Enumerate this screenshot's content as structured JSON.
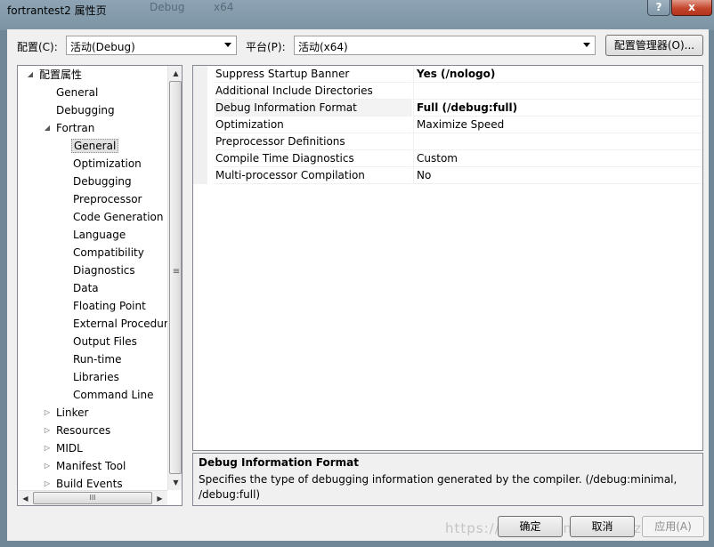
{
  "window": {
    "title": "fortrantest2 属性页",
    "ghost_menu": [
      "Debug",
      "x64"
    ],
    "help_label": "?",
    "close_label": "x"
  },
  "top": {
    "config_label": "配置(C):",
    "config_value": "活动(Debug)",
    "platform_label": "平台(P):",
    "platform_value": "活动(x64)",
    "config_manager": "配置管理器(O)..."
  },
  "tree": {
    "items": [
      {
        "label": "配置属性",
        "expander": "◢"
      },
      {
        "label": "General",
        "expander": ""
      },
      {
        "label": "Debugging",
        "expander": ""
      },
      {
        "label": "Fortran",
        "expander": "◢"
      },
      {
        "label": "General",
        "expander": ""
      },
      {
        "label": "Optimization",
        "expander": ""
      },
      {
        "label": "Debugging",
        "expander": ""
      },
      {
        "label": "Preprocessor",
        "expander": ""
      },
      {
        "label": "Code Generation",
        "expander": ""
      },
      {
        "label": "Language",
        "expander": ""
      },
      {
        "label": "Compatibility",
        "expander": ""
      },
      {
        "label": "Diagnostics",
        "expander": ""
      },
      {
        "label": "Data",
        "expander": ""
      },
      {
        "label": "Floating Point",
        "expander": ""
      },
      {
        "label": "External Procedur",
        "expander": ""
      },
      {
        "label": "Output Files",
        "expander": ""
      },
      {
        "label": "Run-time",
        "expander": ""
      },
      {
        "label": "Libraries",
        "expander": ""
      },
      {
        "label": "Command Line",
        "expander": ""
      },
      {
        "label": "Linker",
        "expander": "▷"
      },
      {
        "label": "Resources",
        "expander": "▷"
      },
      {
        "label": "MIDL",
        "expander": "▷"
      },
      {
        "label": "Manifest Tool",
        "expander": "▷"
      },
      {
        "label": "Build Events",
        "expander": "▷"
      }
    ],
    "hscroll_grip": "III",
    "vscroll_grip": "≡"
  },
  "grid": {
    "rows": [
      {
        "name": "Suppress Startup Banner",
        "value": "Yes (/nologo)",
        "bold": true
      },
      {
        "name": "Additional Include Directories",
        "value": "",
        "bold": false
      },
      {
        "name": "Debug Information Format",
        "value": "Full (/debug:full)",
        "bold": true
      },
      {
        "name": "Optimization",
        "value": "Maximize Speed",
        "bold": false
      },
      {
        "name": "Preprocessor Definitions",
        "value": "",
        "bold": false
      },
      {
        "name": "Compile Time Diagnostics",
        "value": "Custom",
        "bold": false
      },
      {
        "name": "Multi-processor Compilation",
        "value": "No",
        "bold": false
      }
    ]
  },
  "description": {
    "title": "Debug Information Format",
    "line1": "Specifies the type of debugging information generated by the compiler. (/debug:minimal,",
    "line2": "/debug:full)"
  },
  "buttons": {
    "ok": "确定",
    "cancel": "取消",
    "apply": "应用(A)"
  },
  "watermark": "https://blog.csdn.net/zuozhuv"
}
